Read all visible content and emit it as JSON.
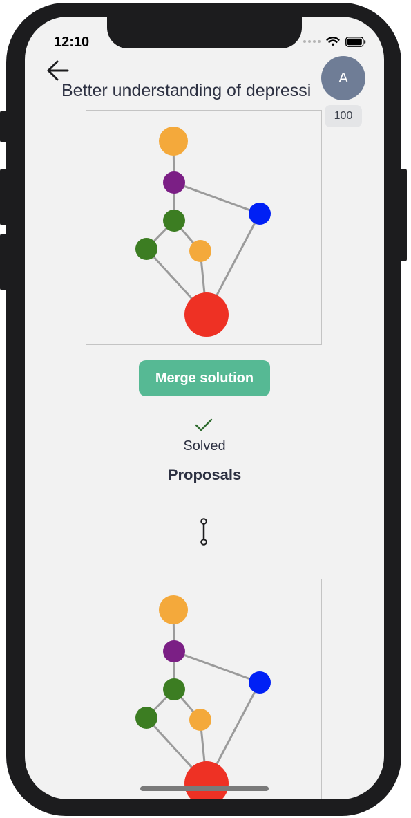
{
  "status_bar": {
    "time": "12:10",
    "icons": [
      "signal-dots-icon",
      "wifi-icon",
      "battery-icon"
    ]
  },
  "header": {
    "back_icon": "arrow-left-icon",
    "title": "Better understanding of depressi",
    "avatar_initial": "A",
    "score": "100"
  },
  "solution_graph": {
    "nodes": [
      {
        "id": "n1",
        "color": "#f4a93b"
      },
      {
        "id": "n2",
        "color": "#7b1f85"
      },
      {
        "id": "n3",
        "color": "#0020f5"
      },
      {
        "id": "n4",
        "color": "#3c7d22"
      },
      {
        "id": "n5",
        "color": "#3c7d22"
      },
      {
        "id": "n6",
        "color": "#f4a93b"
      },
      {
        "id": "n7",
        "color": "#ee3124"
      }
    ],
    "edges": [
      [
        "n1",
        "n2"
      ],
      [
        "n2",
        "n3"
      ],
      [
        "n2",
        "n4"
      ],
      [
        "n4",
        "n5"
      ],
      [
        "n4",
        "n6"
      ],
      [
        "n5",
        "n7"
      ],
      [
        "n6",
        "n7"
      ],
      [
        "n3",
        "n7"
      ]
    ]
  },
  "actions": {
    "merge_label": "Merge solution"
  },
  "status": {
    "check_icon": "checkmark-icon",
    "label": "Solved"
  },
  "proposals": {
    "heading": "Proposals",
    "link_icon": "link-icon"
  },
  "colors": {
    "accent": "#56b994",
    "background": "#f2f2f2",
    "avatar": "#6f7d96",
    "text": "#2d3142",
    "check": "#2e6b2e"
  }
}
